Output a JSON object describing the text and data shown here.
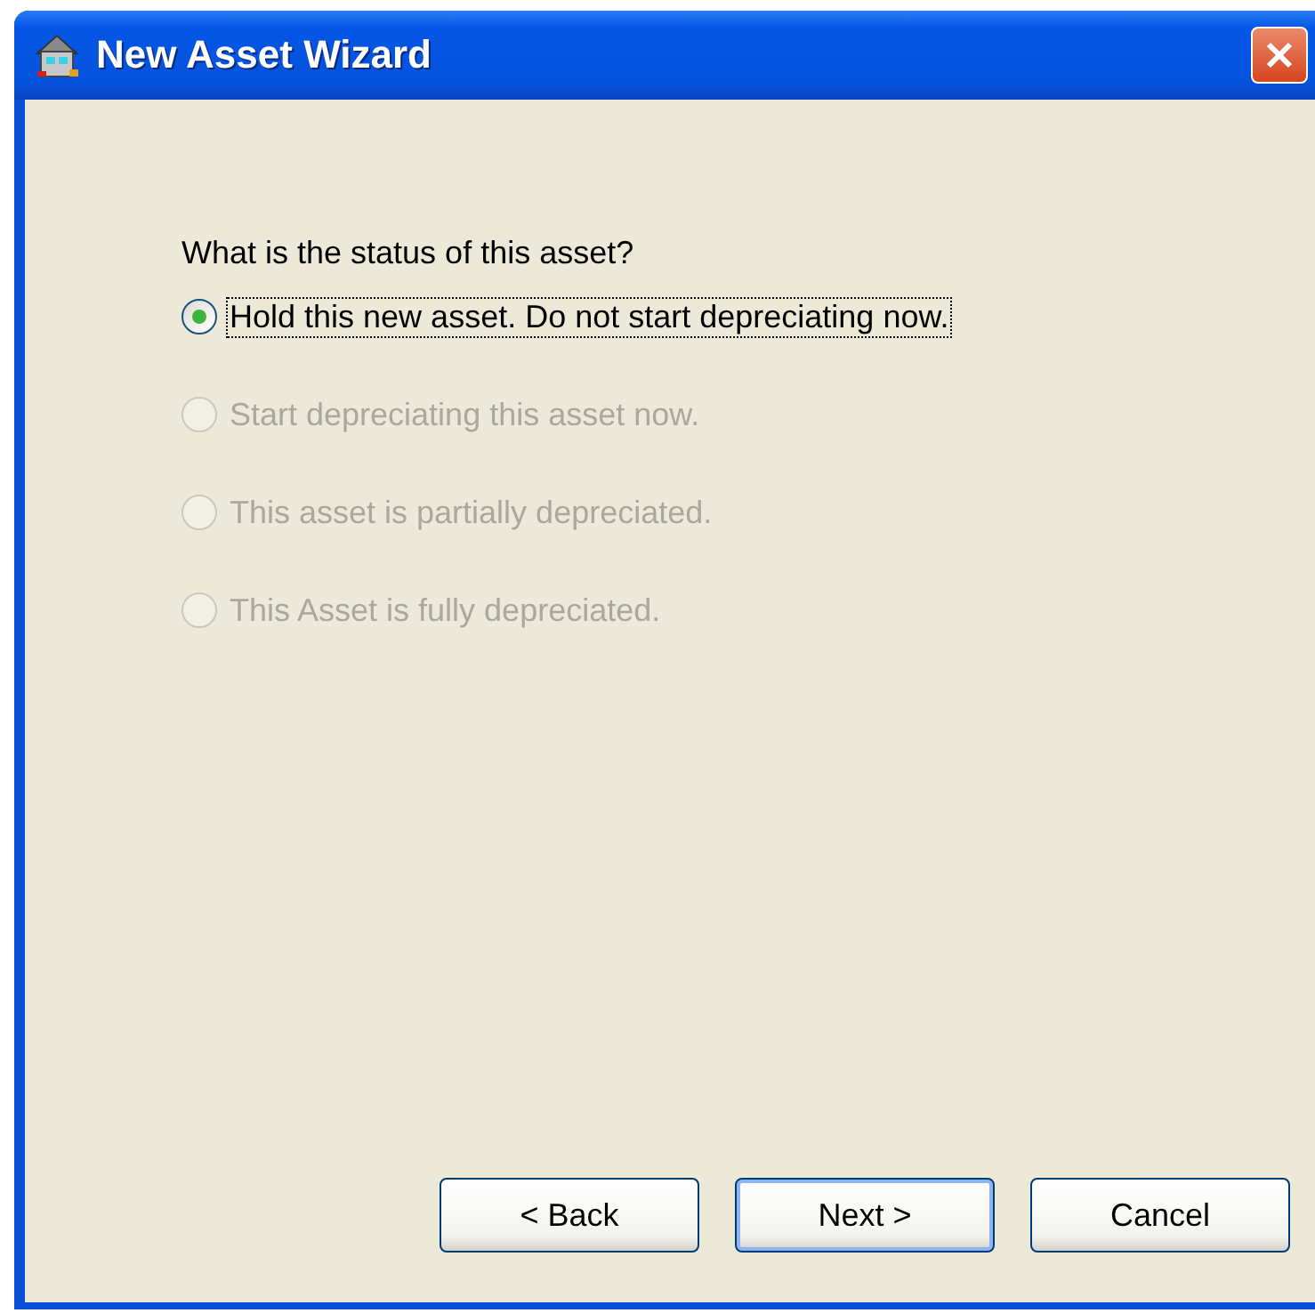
{
  "window": {
    "title": "New Asset Wizard"
  },
  "question": "What is the status of this asset?",
  "options": [
    {
      "label": "Hold this new asset. Do not start depreciating now.",
      "selected": true,
      "disabled": false,
      "focused": true
    },
    {
      "label": "Start depreciating this asset now.",
      "selected": false,
      "disabled": true,
      "focused": false
    },
    {
      "label": "This asset is partially depreciated.",
      "selected": false,
      "disabled": true,
      "focused": false
    },
    {
      "label": "This Asset is fully depreciated.",
      "selected": false,
      "disabled": true,
      "focused": false
    }
  ],
  "buttons": [
    {
      "label": "< Back",
      "default": false
    },
    {
      "label": "Next >",
      "default": true
    },
    {
      "label": "Cancel",
      "default": false
    }
  ]
}
